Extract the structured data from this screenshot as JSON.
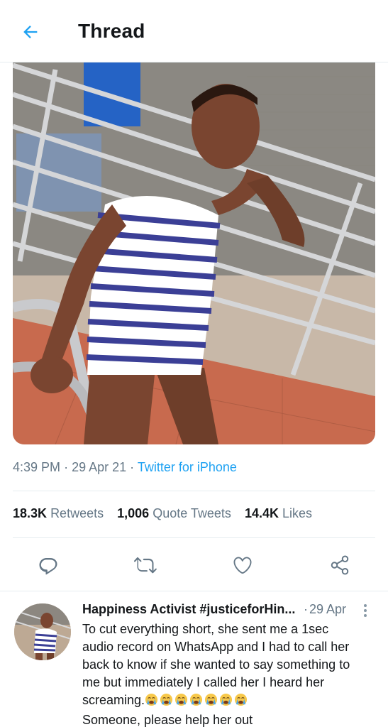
{
  "header": {
    "title": "Thread",
    "back_icon": "arrow-left-icon"
  },
  "tweet": {
    "media_description_icon": "photo",
    "time": "4:39 PM",
    "date": "29 Apr 21",
    "source": "Twitter for iPhone",
    "stats": {
      "retweets_count": "18.3K",
      "retweets_label": "Retweets",
      "quotes_count": "1,006",
      "quotes_label": "Quote Tweets",
      "likes_count": "14.4K",
      "likes_label": "Likes"
    },
    "actions": [
      "reply-icon",
      "retweet-icon",
      "like-icon",
      "share-icon"
    ]
  },
  "reply": {
    "name": "Happiness Activist #justiceforHin...",
    "date": "29 Apr",
    "line1": "To cut everything short,  she sent me a 1sec",
    "line2": "audio record on WhatsApp and I had to call her",
    "line3": "back to know if she wanted to say something to",
    "line4": "me but immediately I called her  I heard her",
    "line5": "screaming.",
    "emoji_count": 7,
    "emoji": "crying-face",
    "line6": "Someone, please help her out"
  },
  "colors": {
    "accent": "#1da1f2",
    "muted": "#657786",
    "text": "#14171a",
    "divider": "#e6ecf0"
  }
}
